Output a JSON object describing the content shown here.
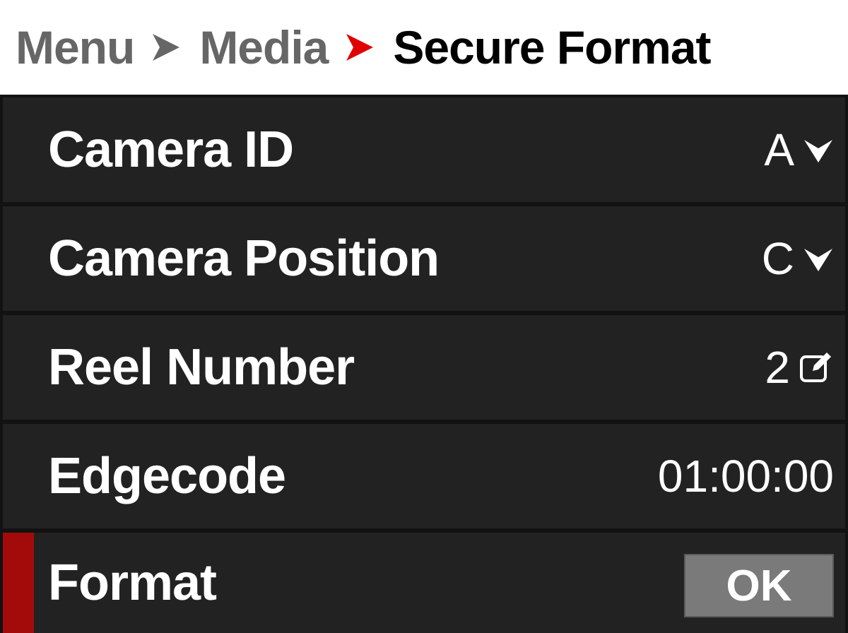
{
  "breadcrumb": {
    "items": [
      "Menu",
      "Media",
      "Secure Format"
    ],
    "separator_icon": "chevron-right-icon",
    "active_separator_color": "#e00000",
    "inactive_separator_color": "#666666"
  },
  "settings": {
    "camera_id": {
      "label": "Camera ID",
      "value": "A",
      "icon": "chevron-down-icon"
    },
    "camera_position": {
      "label": "Camera Position",
      "value": "C",
      "icon": "chevron-down-icon"
    },
    "reel_number": {
      "label": "Reel Number",
      "value": "2",
      "icon": "edit-icon"
    },
    "edgecode": {
      "label": "Edgecode",
      "value": "01:00:00"
    },
    "format": {
      "label": "Format",
      "button_label": "OK",
      "selected": true
    }
  },
  "colors": {
    "selection_accent": "#a30b0b",
    "row_background": "#222222",
    "button_background": "#7a7a7a"
  }
}
